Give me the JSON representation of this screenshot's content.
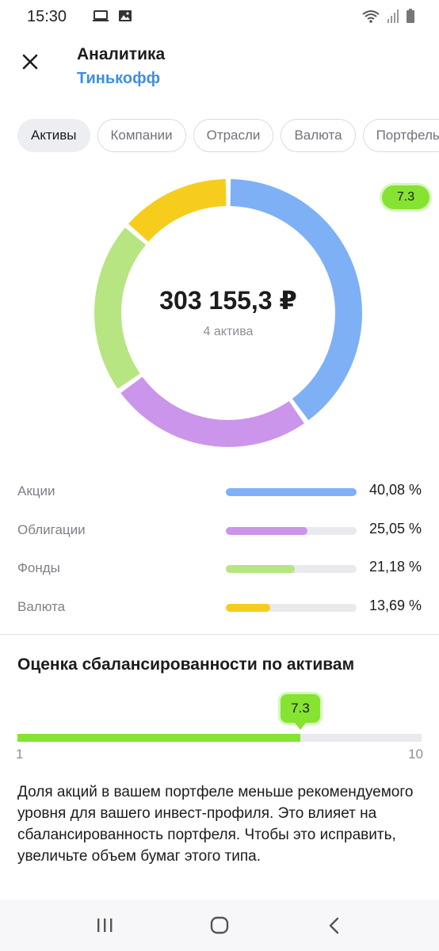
{
  "status_bar": {
    "time": "15:30",
    "left_icons": [
      "laptop-icon",
      "image-icon"
    ],
    "right_icons": [
      "wifi-icon",
      "signal-icon",
      "battery-icon"
    ]
  },
  "header": {
    "close_icon": "close-icon",
    "title": "Аналитика",
    "subtitle": "Тинькофф"
  },
  "tabs": [
    {
      "label": "Активы",
      "active": true
    },
    {
      "label": "Компании",
      "active": false
    },
    {
      "label": "Отрасли",
      "active": false
    },
    {
      "label": "Валюта",
      "active": false
    },
    {
      "label": "Портфель",
      "active": false
    }
  ],
  "donut": {
    "total": "303 155,3 ₽",
    "caption": "4 актива"
  },
  "score_badge": "7.3",
  "allocation": [
    {
      "label": "Акции",
      "value": "40,08 %",
      "fraction": 0.4008,
      "color": "#7eb0f5"
    },
    {
      "label": "Облигации",
      "value": "25,05 %",
      "fraction": 0.2505,
      "color": "#cb95ec"
    },
    {
      "label": "Фонды",
      "value": "21,18 %",
      "fraction": 0.2118,
      "color": "#b6e581"
    },
    {
      "label": "Валюта",
      "value": "13,69 %",
      "fraction": 0.1369,
      "color": "#f7cd1d"
    }
  ],
  "balance": {
    "title": "Оценка сбалансированности по активам",
    "score": "7.3",
    "score_value": 7.3,
    "min": "1",
    "max": "10",
    "min_value": 1,
    "max_value": 10,
    "accent": "#86e332",
    "advice": "Доля акций в вашем портфеле меньше рекомендуемого уровня для вашего инвест-профиля. Это влияет на сбалансированность портфеля. Чтобы это исправить, увеличьте объем бумаг этого типа."
  },
  "nav_bar": [
    "recent-apps-icon",
    "home-icon",
    "back-icon"
  ]
}
